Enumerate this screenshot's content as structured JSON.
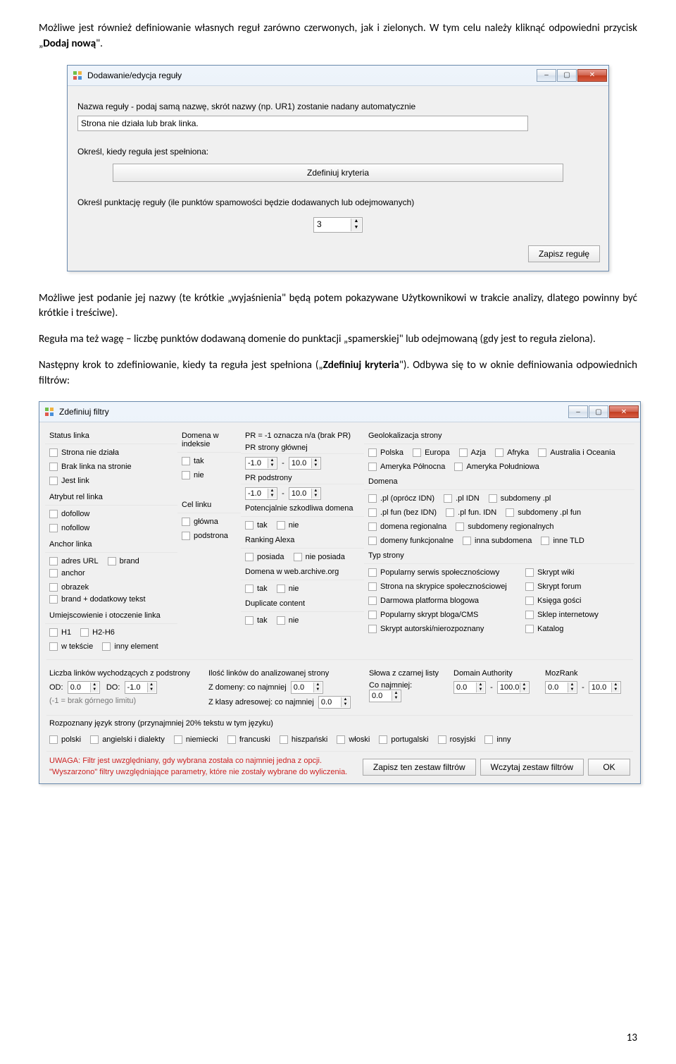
{
  "para1_a": "Możliwe jest również definiowanie własnych reguł zarówno czerwonych, jak i zielonych. W tym celu należy kliknąć odpowiedni przycisk „",
  "para1_b": "Dodaj nową",
  "para1_c": "\".",
  "para2": "Możliwe jest podanie jej nazwy (te krótkie „wyjaśnienia\" będą potem pokazywane Użytkownikowi w trakcie analizy, dlatego powinny być krótkie i treściwe).",
  "para3": "Reguła ma też wagę – liczbę punktów dodawaną domenie do punktacji „spamerskiej\" lub odejmowaną (gdy jest to reguła zielona).",
  "para4_a": "Następny krok to zdefiniowanie, kiedy ta reguła jest spełniona („",
  "para4_b": "Zdefiniuj kryteria",
  "para4_c": "\"). Odbywa się to w oknie definiowania odpowiednich filtrów:",
  "page_num": "13",
  "dlg1": {
    "title": "Dodawanie/edycja reguły",
    "l1": "Nazwa reguły - podaj samą nazwę, skrót nazwy (np. UR1) zostanie nadany automatycznie",
    "input1": "Strona nie działa lub brak linka.",
    "l2": "Określ, kiedy reguła jest spełniona:",
    "btn_kryteria": "Zdefiniuj kryteria",
    "l3": "Określ punktację reguły (ile punktów spamowości będzie dodawanych lub odejmowanych)",
    "spin_val": "3",
    "save": "Zapisz regułę"
  },
  "dlg2": {
    "title": "Zdefiniuj filtry",
    "status_linka": "Status linka",
    "status": {
      "a": "Strona nie działa",
      "b": "Brak linka na stronie",
      "c": "Jest link"
    },
    "atrybut_rel": "Atrybut rel linka",
    "rel": {
      "a": "dofollow",
      "b": "nofollow"
    },
    "anchor_linka": "Anchor linka",
    "anchor": {
      "a": "adres URL",
      "b": "brand",
      "c": "anchor",
      "d": "obrazek",
      "e": "brand + dodatkowy tekst"
    },
    "umiejscowienie": "Umiejscowienie i otoczenie linka",
    "um": {
      "a": "H1",
      "b": "H2-H6",
      "c": "w tekście",
      "d": "inny element"
    },
    "domena_idx": "Domena w indeksie",
    "cel_linku": "Cel linku",
    "cel": {
      "a": "główna",
      "b": "podstrona"
    },
    "pr_head": "PR = -1 oznacza n/a (brak PR)",
    "pr_glowna": "PR strony głównej",
    "pr_podstrona": "PR podstrony",
    "pot_szk": "Potencjalnie szkodliwa domena",
    "ranking_alexa": "Ranking Alexa",
    "alexa": {
      "a": "posiada",
      "b": "nie posiada"
    },
    "archive": "Domena w web.archive.org",
    "dup": "Duplicate content",
    "tak": "tak",
    "nie": "nie",
    "vneg1": "-1.0",
    "v10": "10.0",
    "geo": "Geolokalizacja strony",
    "g": {
      "pl": "Polska",
      "eu": "Europa",
      "as": "Azja",
      "af": "Afryka",
      "aio": "Australia i Oceania",
      "an": "Ameryka Północna",
      "ap": "Ameryka Południowa"
    },
    "domena": "Domena",
    "d": {
      "a": ".pl (oprócz IDN)",
      "b": ".pl IDN",
      "c": "subdomeny .pl",
      "d": ".pl fun (bez IDN)",
      "e": ".pl fun. IDN",
      "f": "subdomeny .pl fun",
      "g": "domena regionalna",
      "h": "subdomeny regionalnych",
      "i": "domeny funkcjonalne",
      "j": "inna subdomena",
      "k": "inne TLD"
    },
    "typ": "Typ strony",
    "t": {
      "a": "Popularny serwis społecznościowy",
      "b": "Skrypt wiki",
      "c": "Strona na skrypice społecznościowej",
      "d": "Skrypt forum",
      "e": "Darmowa platforma blogowa",
      "f": "Księga gości",
      "g": "Popularny skrypt bloga/CMS",
      "h": "Sklep internetowy",
      "i": "Skrypt autorski/nierozpoznany",
      "j": "Katalog"
    },
    "liczba_out": "Liczba linków wychodzących z podstrony",
    "od": "OD:",
    "do": "DO:",
    "v0": "0.0",
    "vm1": "-1.0",
    "limit_note": "(-1 = brak górnego limitu)",
    "ilosc_head": "Ilość linków do analizowanej strony",
    "il_dom": "Z domeny: co najmniej",
    "il_kl": "Z klasy adresowej: co najmniej",
    "slowa": "Słowa z czarnej listy",
    "dauth": "Domain Authority",
    "mozrank": "MozRank",
    "conajm": "Co najmniej:",
    "v100": "100.0",
    "jezyk": "Rozpoznany język strony (przynajmniej 20% tekstu w tym języku)",
    "lang": {
      "pl": "polski",
      "en": "angielski i dialekty",
      "de": "niemiecki",
      "fr": "francuski",
      "es": "hiszpański",
      "it": "włoski",
      "pt": "portugalski",
      "ru": "rosyjski",
      "in": "inny"
    },
    "uwaga1": "UWAGA: Filtr jest uwzględniany, gdy wybrana została co najmniej jedna z opcji.",
    "uwaga2": "\"Wyszarzono\" filtry uwzględniające parametry, które nie zostały wybrane do wyliczenia.",
    "btn_zap": "Zapisz ten zestaw filtrów",
    "btn_wcz": "Wczytaj zestaw filtrów",
    "btn_ok": "OK"
  }
}
